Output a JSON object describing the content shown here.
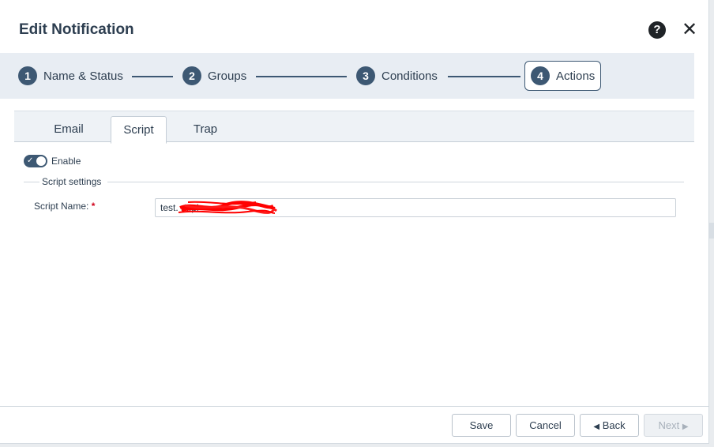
{
  "dialog": {
    "title": "Edit Notification",
    "help_icon": "question-circle-icon",
    "close_icon": "close-icon"
  },
  "stepper": {
    "steps": [
      {
        "number": "1",
        "label": "Name & Status"
      },
      {
        "number": "2",
        "label": "Groups"
      },
      {
        "number": "3",
        "label": "Conditions"
      },
      {
        "number": "4",
        "label": "Actions",
        "active": true
      }
    ]
  },
  "tabs": {
    "items": [
      "Email",
      "Script",
      "Trap"
    ],
    "active": "Script"
  },
  "enable_toggle": {
    "label": "Enable",
    "on": true
  },
  "script_settings": {
    "legend": "Script settings",
    "script_name_label": "Script Name:",
    "required_marker": "*",
    "script_name_value": "test.                        m.pl"
  },
  "footer": {
    "save_label": "Save",
    "cancel_label": "Cancel",
    "back_label": "Back",
    "next_label": "Next"
  },
  "colors": {
    "accent": "#3d5873",
    "stepper_bg": "#e8edf3",
    "required": "#d0021b",
    "redaction": "#ff0000"
  }
}
